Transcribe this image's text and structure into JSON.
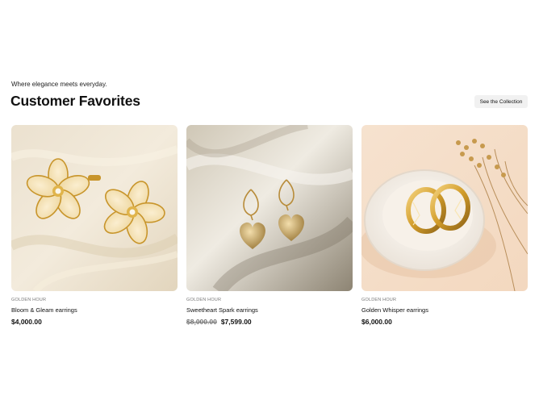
{
  "section": {
    "tagline": "Where elegance meets everyday.",
    "title": "Customer Favorites",
    "cta_label": "See the Collection"
  },
  "products": [
    {
      "brand": "GOLDEN HOUR",
      "name": "Bloom & Gleam earrings",
      "old_price": "",
      "price": "$4,000.00",
      "image": "flower-earrings-on-cream-silk"
    },
    {
      "brand": "GOLDEN HOUR",
      "name": "Sweetheart Spark earrings",
      "old_price": "$8,000.00",
      "price": "$7,599.00",
      "image": "heart-drop-earrings-on-white-linen"
    },
    {
      "brand": "GOLDEN HOUR",
      "name": "Golden Whisper earrings",
      "old_price": "",
      "price": "$6,000.00",
      "image": "twisted-gold-hoops-in-ceramic-dish"
    }
  ],
  "colors": {
    "gold": "#d4a53a",
    "cta_bg": "#f1f1f1",
    "muted_text": "#777777"
  }
}
